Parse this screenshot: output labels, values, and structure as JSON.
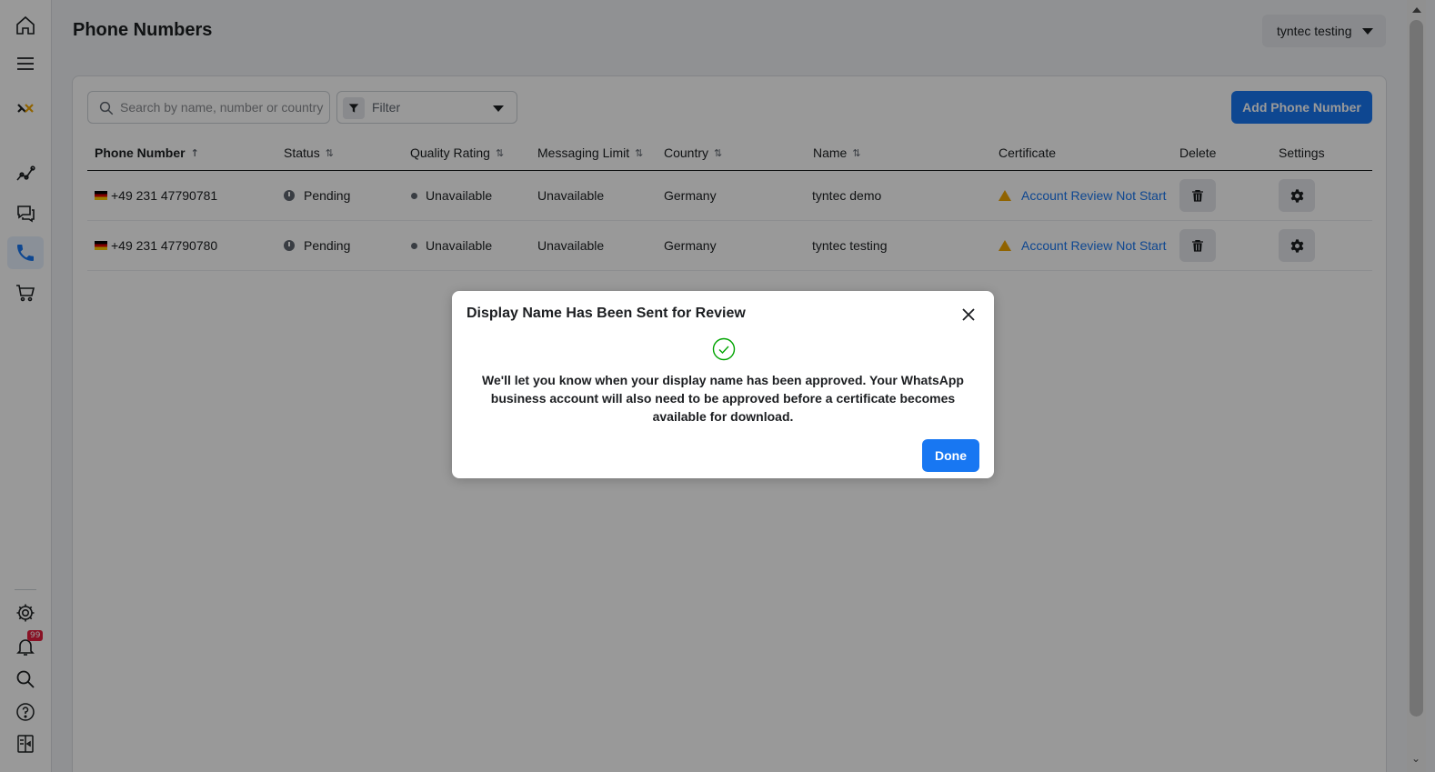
{
  "page": {
    "title": "Phone Numbers"
  },
  "account_selector": {
    "value": "tyntec testing"
  },
  "toolbar": {
    "search_placeholder": "Search by name, number or country",
    "filter_label": "Filter",
    "add_button": "Add Phone Number"
  },
  "table": {
    "headers": {
      "phone_number": "Phone Number",
      "status": "Status",
      "quality_rating": "Quality Rating",
      "messaging_limit": "Messaging Limit",
      "country": "Country",
      "name": "Name",
      "certificate": "Certificate",
      "delete": "Delete",
      "settings": "Settings"
    },
    "rows": [
      {
        "phone": "+49 231 47790781",
        "status": "Pending",
        "quality": "Unavailable",
        "limit": "Unavailable",
        "country": "Germany",
        "name": "tyntec demo",
        "certificate": "Account Review Not Started"
      },
      {
        "phone": "+49 231 47790780",
        "status": "Pending",
        "quality": "Unavailable",
        "limit": "Unavailable",
        "country": "Germany",
        "name": "tyntec testing",
        "certificate": "Account Review Not Started"
      }
    ]
  },
  "sidebar": {
    "notification_badge": "99",
    "icons": [
      "home-icon",
      "menu-icon",
      "logo-icon",
      "insights-icon",
      "chat-icon",
      "phone-icon",
      "cart-icon",
      "settings-icon",
      "bell-icon",
      "search-icon",
      "help-icon",
      "panel-icon"
    ]
  },
  "modal": {
    "title": "Display Name Has Been Sent for Review",
    "body": "We'll let you know when your display name has been approved. Your WhatsApp business account will also need to be approved before a certificate becomes available for download.",
    "done_button": "Done"
  },
  "colors": {
    "accent": "#1877f2",
    "success": "#00a400",
    "warning": "#f0a500"
  }
}
